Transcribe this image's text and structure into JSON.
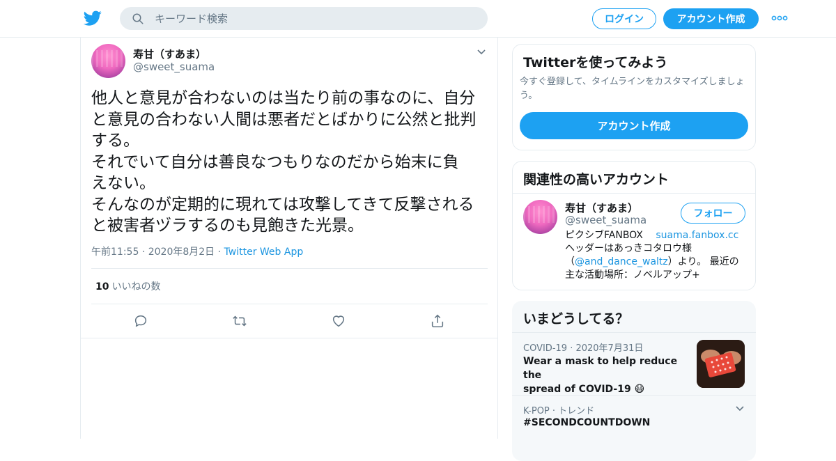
{
  "header": {
    "search_placeholder": "キーワード検索",
    "login_label": "ログイン",
    "signup_label": "アカウント作成",
    "accent_color": "#1da1f2"
  },
  "tweet": {
    "author_name": "寿甘（すあま）",
    "author_handle": "@sweet_suama",
    "text_lines": [
      "他人と意見が合わないのは当たり前の事なのに、自分",
      "と意見の合わない人間は悪者だとばかりに公然と批判",
      "する。",
      "それでいて自分は善良なつもりなのだから始末に負",
      "えない。",
      "そんなのが定期的に現れては攻撃してきて反撃される",
      "と被害者ヅラするのも見飽きた光景。"
    ],
    "time": "午前11:55",
    "date": "2020年8月2日",
    "source": "Twitter Web App",
    "like_count": "10",
    "like_label": "いいねの数"
  },
  "signup_card": {
    "title": "Twitterを使ってみよう",
    "desc_line1": "今すぐ登録して、タイムラインをカスタマイズしましょ",
    "desc_line2": "う。",
    "button_label": "アカウント作成"
  },
  "related": {
    "title": "関連性の高いアカウント",
    "name": "寿甘（すあま）",
    "handle": "@sweet_suama",
    "follow_label": "フォロー",
    "bio_prefix": "ピクシブFANBOX",
    "bio_link": "suama.fanbox.cc",
    "bio_line2": "ヘッダーはあっきコタロウ様",
    "bio_line3_open": "（",
    "bio_mention": "@and_dance_waltz",
    "bio_line3_close": "）より。 最近の",
    "bio_line4": "主な活動場所：ノベルアップ+"
  },
  "trends": {
    "title": "いまどうしてる？",
    "items": [
      {
        "category": "COVID-19",
        "date": "2020年7月31日",
        "text_line1": "Wear a mask to help reduce the",
        "text_line2": "spread of COVID-19 😷"
      },
      {
        "category": "K-POP",
        "tag": "トレンド",
        "text": "#SECONDCOUNTDOWN"
      }
    ]
  }
}
